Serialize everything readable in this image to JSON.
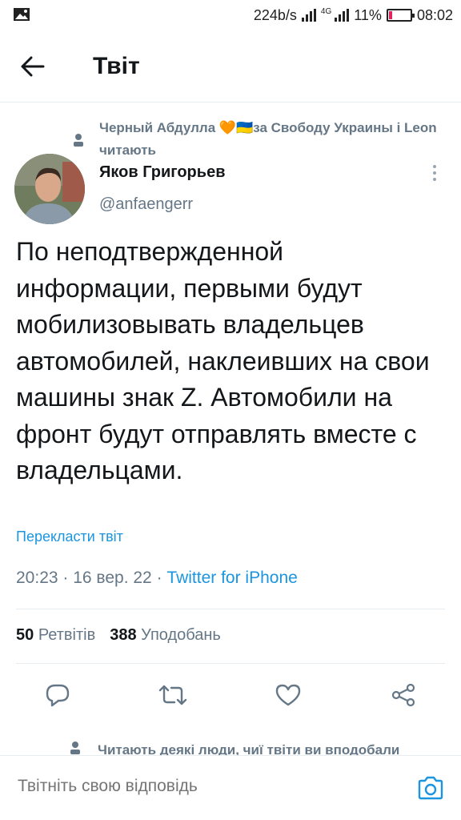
{
  "status_bar": {
    "network_speed": "224b/s",
    "network_type": "4G",
    "battery": "11%",
    "time": "08:02"
  },
  "header": {
    "title": "Твіт"
  },
  "social_context": "Черный Абдулла 🧡🇺🇦за Свободу Украины і Leon читають",
  "author": {
    "name": "Яков Григорьев",
    "handle": "@anfaengerr"
  },
  "tweet": {
    "text": "По неподтвержденной информации, первыми будут мобилизовывать владельцев автомобилей, наклеивших на свои машины знак Z. Автомобили на фронт будут отправлять вместе с владельцами.",
    "translate_label": "Перекласти твіт",
    "time": "20:23",
    "date": "16 вер. 22",
    "client": "Twitter for iPhone"
  },
  "stats": {
    "retweets_count": "50",
    "retweets_label": "Ретвітів",
    "likes_count": "388",
    "likes_label": "Уподобань"
  },
  "bottom_context": "Читають деякі люди, чиї твіти ви вподобали",
  "reply": {
    "placeholder": "Твітніть свою відповідь"
  },
  "colors": {
    "accent": "#1b95e0",
    "secondary_text": "#657786",
    "divider": "#e6ecf0"
  },
  "icons": [
    "image-icon",
    "signal-icon",
    "battery-icon",
    "back-arrow-icon",
    "person-icon",
    "more-vertical-icon",
    "reply-icon",
    "retweet-icon",
    "like-icon",
    "share-icon",
    "camera-icon"
  ]
}
